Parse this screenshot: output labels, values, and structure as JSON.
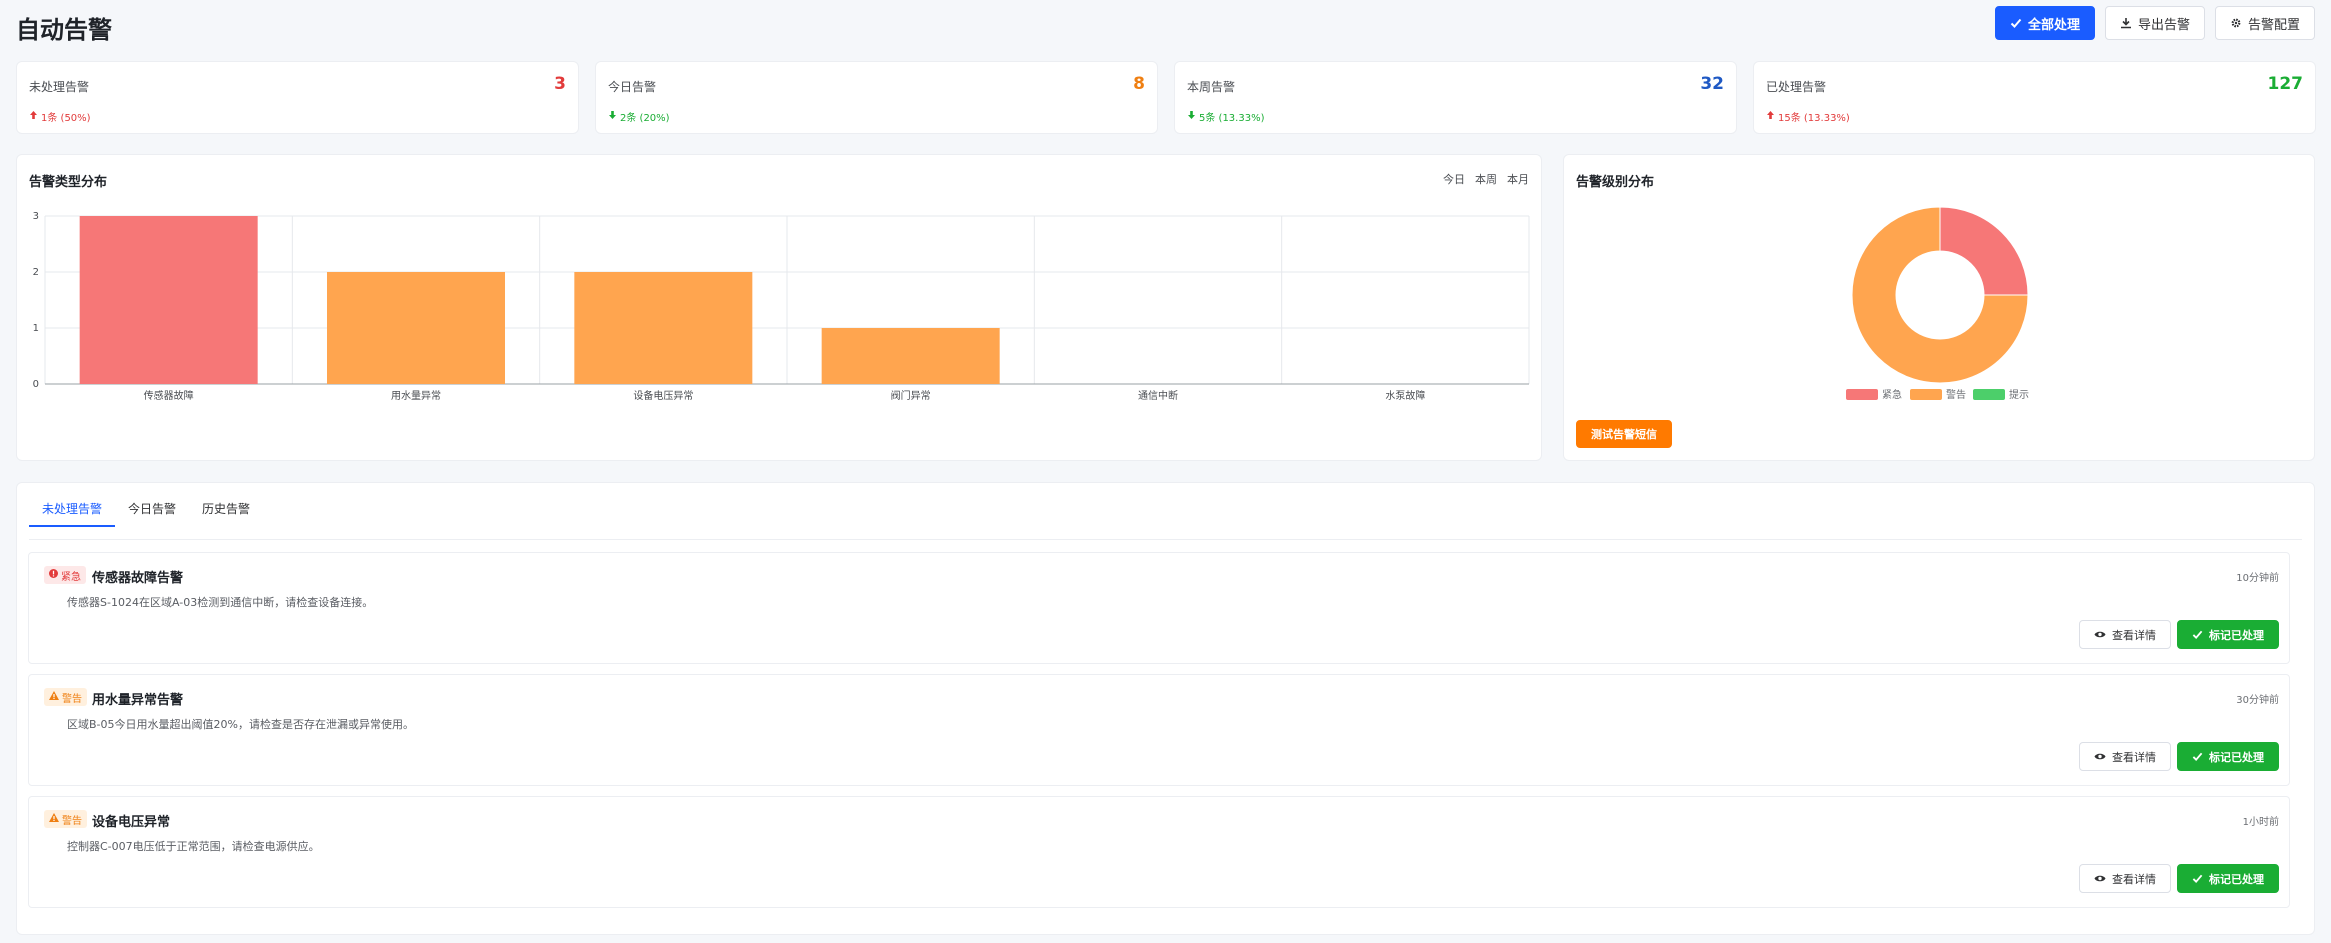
{
  "header": {
    "title": "自动告警",
    "buttons": {
      "process_all": "全部处理",
      "export": "导出告警",
      "config": "告警配置"
    }
  },
  "stats": [
    {
      "label": "未处理告警",
      "value": "3",
      "trend": "1条 (50%)",
      "direction": "up",
      "color": "#e23b3b"
    },
    {
      "label": "今日告警",
      "value": "8",
      "trend": "2条 (20%)",
      "direction": "down",
      "color": "#ef7f12"
    },
    {
      "label": "本周告警",
      "value": "32",
      "trend": "5条 (13.33%)",
      "direction": "down",
      "color": "#1f59c4"
    },
    {
      "label": "已处理告警",
      "value": "127",
      "trend": "15条 (13.33%)",
      "direction": "up",
      "color": "#1aad34"
    }
  ],
  "bar_section": {
    "title": "告警类型分布",
    "tabs": [
      "今日",
      "本周",
      "本月"
    ]
  },
  "pie_section": {
    "title": "告警级别分布",
    "test_button": "测试告警短信"
  },
  "chart_data": [
    {
      "type": "bar",
      "categories": [
        "传感器故障",
        "用水量异常",
        "设备电压异常",
        "阀门异常",
        "通信中断",
        "水泵故障"
      ],
      "values": [
        3,
        2,
        2,
        1,
        0,
        0
      ],
      "colors": [
        "#f67777",
        "#ffa54f",
        "#ffa54f",
        "#ffa54f",
        "#ffa54f",
        "#ffa54f"
      ],
      "ylim": [
        0,
        3
      ],
      "yticks": [
        0,
        1,
        2,
        3
      ],
      "grid": true
    },
    {
      "type": "pie",
      "donut": true,
      "labels": [
        "紧急",
        "警告",
        "提示"
      ],
      "values": [
        1,
        3,
        0
      ],
      "colors": [
        "#f67777",
        "#ffa54f",
        "#4ccf6a"
      ],
      "legend": "bottom"
    }
  ],
  "tabs": [
    "未处理告警",
    "今日告警",
    "历史告警"
  ],
  "alerts": [
    {
      "level": "紧急",
      "level_type": "urgent",
      "title": "传感器故障告警",
      "desc": "传感器S-1024在区域A-03检测到通信中断，请检查设备连接。",
      "time": "10分钟前"
    },
    {
      "level": "警告",
      "level_type": "warn",
      "title": "用水量异常告警",
      "desc": "区域B-05今日用水量超出阈值20%，请检查是否存在泄漏或异常使用。",
      "time": "30分钟前"
    },
    {
      "level": "警告",
      "level_type": "warn",
      "title": "设备电压异常",
      "desc": "控制器C-007电压低于正常范围，请检查电源供应。",
      "time": "1小时前"
    }
  ],
  "alert_buttons": {
    "view": "查看详情",
    "mark": "标记已处理"
  },
  "icons": {
    "check": "check-icon",
    "download": "download-icon",
    "gear": "gear-icon",
    "eye": "eye-icon",
    "arrow_up": "arrow-up-icon",
    "arrow_down": "arrow-down-icon",
    "exclamation": "exclamation-circle-icon",
    "warning": "warning-triangle-icon"
  }
}
